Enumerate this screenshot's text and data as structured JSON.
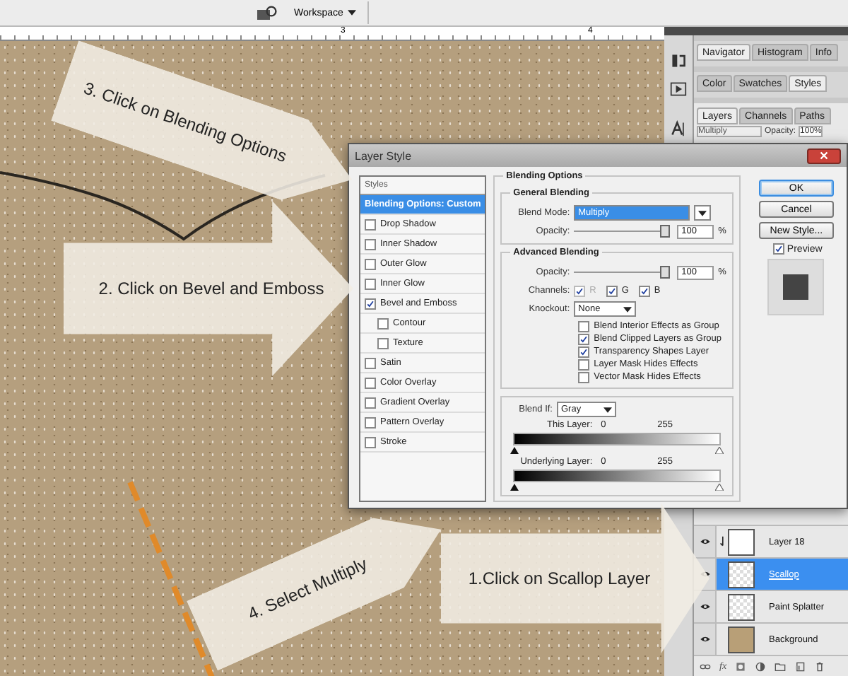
{
  "app_bar": {
    "workspace": "Workspace"
  },
  "ruler": {
    "labels": [
      "3",
      "4"
    ]
  },
  "panel_groups": [
    {
      "tabs": [
        {
          "label": "Navigator",
          "selected": true
        },
        {
          "label": "Histogram",
          "selected": false
        },
        {
          "label": "Info",
          "selected": false
        }
      ]
    },
    {
      "tabs": [
        {
          "label": "Color",
          "selected": false
        },
        {
          "label": "Swatches",
          "selected": false
        },
        {
          "label": "Styles",
          "selected": true
        }
      ]
    }
  ],
  "layers_panel": {
    "tabs": [
      {
        "label": "Layers",
        "selected": true
      },
      {
        "label": "Channels",
        "selected": false
      },
      {
        "label": "Paths",
        "selected": false
      }
    ],
    "blend_mode": "Multiply",
    "opacity_label": "Opacity:",
    "opacity": "100%",
    "layers": [
      {
        "name": "Layer 18",
        "kind": "white",
        "clipped": true,
        "visible": true,
        "selected": false
      },
      {
        "name": "Scallop",
        "kind": "transparent",
        "clipped": false,
        "visible": true,
        "selected": true
      },
      {
        "name": "Paint Splatter",
        "kind": "transparent",
        "clipped": false,
        "visible": true,
        "selected": false
      },
      {
        "name": "Background",
        "kind": "fill",
        "clipped": false,
        "visible": true,
        "selected": false
      }
    ],
    "footer_label": "fx"
  },
  "dialog": {
    "title": "Layer Style",
    "styles_header": "Styles",
    "styles": [
      {
        "label": "Blending Options: Custom",
        "kind": "option",
        "selected": true
      },
      {
        "label": "Drop Shadow",
        "kind": "effect",
        "checked": false,
        "selected": false
      },
      {
        "label": "Inner Shadow",
        "kind": "effect",
        "checked": false,
        "selected": false
      },
      {
        "label": "Outer Glow",
        "kind": "effect",
        "checked": false,
        "selected": false
      },
      {
        "label": "Inner Glow",
        "kind": "effect",
        "checked": false,
        "selected": false
      },
      {
        "label": "Bevel and Emboss",
        "kind": "effect",
        "checked": true,
        "selected": false,
        "children": [
          {
            "label": "Contour",
            "kind": "effect",
            "checked": false,
            "selected": false
          },
          {
            "label": "Texture",
            "kind": "effect",
            "checked": false,
            "selected": false
          }
        ]
      },
      {
        "label": "Satin",
        "kind": "effect",
        "checked": false,
        "selected": false
      },
      {
        "label": "Color Overlay",
        "kind": "effect",
        "checked": false,
        "selected": false
      },
      {
        "label": "Gradient Overlay",
        "kind": "effect",
        "checked": false,
        "selected": false
      },
      {
        "label": "Pattern Overlay",
        "kind": "effect",
        "checked": false,
        "selected": false
      },
      {
        "label": "Stroke",
        "kind": "effect",
        "checked": false,
        "selected": false
      }
    ],
    "blending": {
      "title": "Blending Options",
      "general": {
        "title": "General Blending",
        "blend_mode_label": "Blend Mode:",
        "blend_mode": "Multiply",
        "opacity": {
          "label": "Opacity:",
          "value": "100",
          "unit": "%",
          "level": 1
        }
      },
      "advanced": {
        "title": "Advanced Blending",
        "fill_opacity": {
          "label": "Opacity:",
          "value": "100",
          "unit": "%",
          "level": 1
        },
        "channels_label": "Channels:",
        "channels": [
          {
            "label": "R",
            "checked": true,
            "disabled": true
          },
          {
            "label": "G",
            "checked": true,
            "disabled": false
          },
          {
            "label": "B",
            "checked": true,
            "disabled": false
          }
        ],
        "knockout_label": "Knockout:",
        "knockout": "None",
        "options": [
          {
            "label": "Blend Interior Effects as Group",
            "checked": false
          },
          {
            "label": "Blend Clipped Layers as Group",
            "checked": true
          },
          {
            "label": "Transparency Shapes Layer",
            "checked": true
          },
          {
            "label": "Layer Mask Hides Effects",
            "checked": false
          },
          {
            "label": "Vector Mask Hides Effects",
            "checked": false
          }
        ]
      },
      "blend_if": {
        "label": "Blend If:",
        "value": "Gray",
        "this_layer": {
          "label": "This Layer:",
          "low": "0",
          "high": "255"
        },
        "underlying_layer": {
          "label": "Underlying Layer:",
          "low": "0",
          "high": "255"
        }
      }
    },
    "buttons": [
      {
        "label": "OK",
        "default": true
      },
      {
        "label": "Cancel",
        "default": false
      },
      {
        "label": "New Style...",
        "default": false
      }
    ],
    "preview": {
      "label": "Preview",
      "checked": true
    }
  },
  "callouts": [
    {
      "text": "3. Click on Blending Options"
    },
    {
      "text": "2. Click on Bevel and Emboss"
    },
    {
      "text": "4. Select Multiply"
    },
    {
      "text": "1.Click on Scallop Layer"
    }
  ]
}
